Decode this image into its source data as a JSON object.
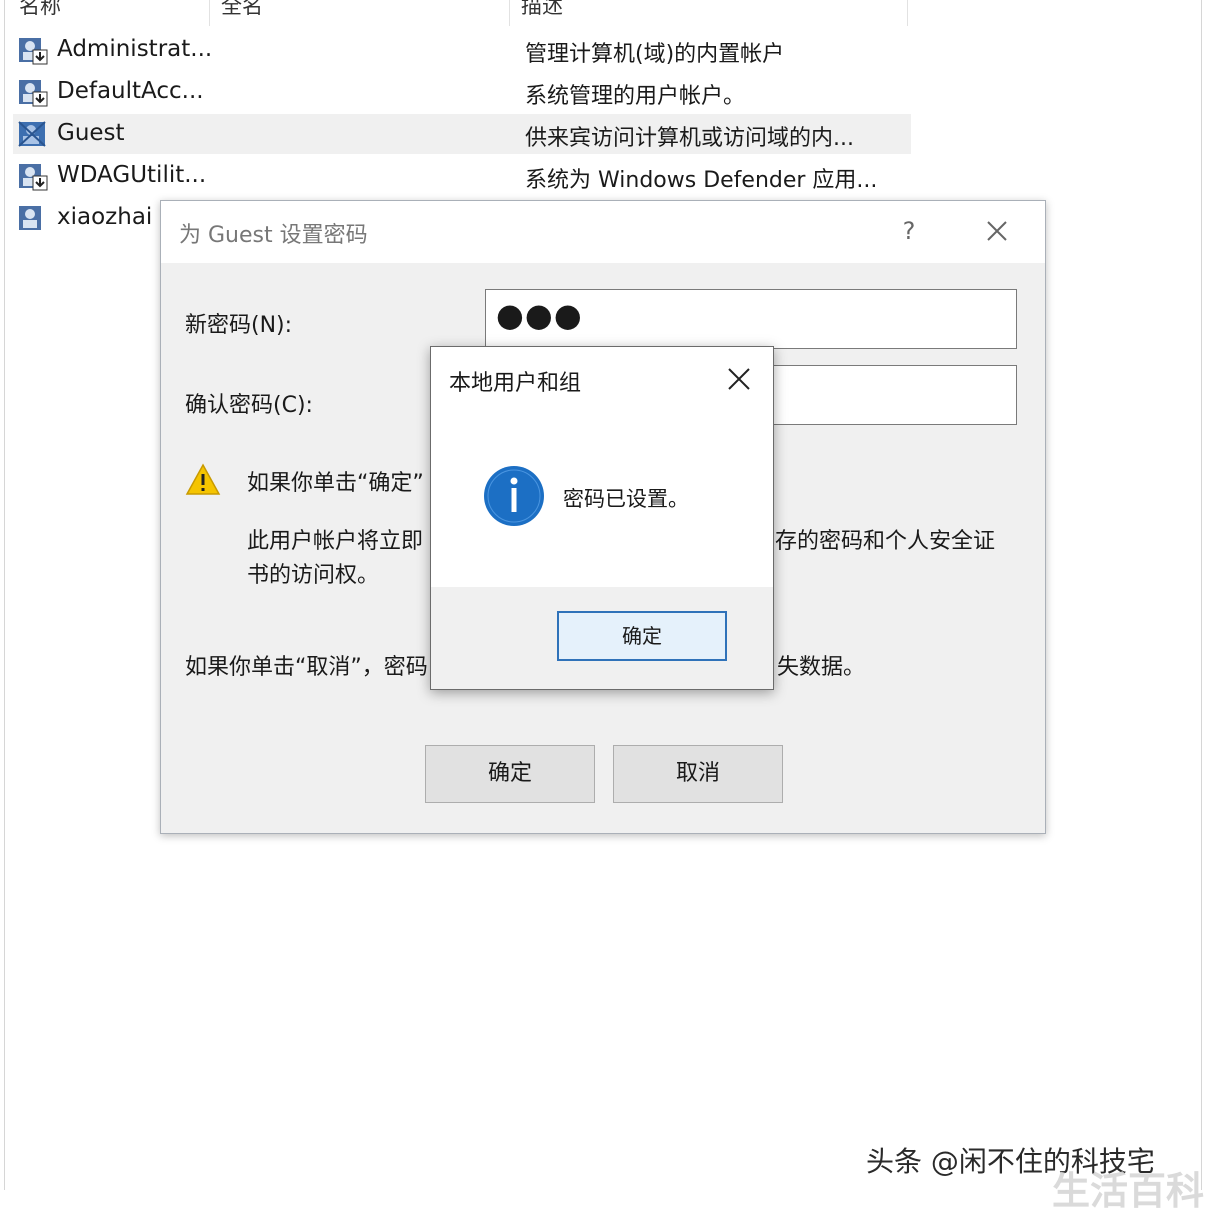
{
  "listview": {
    "columns": [
      "名称",
      "全名",
      "描述"
    ],
    "rows": [
      {
        "name": "Administrat...",
        "fullname": "",
        "desc": "管理计算机(域)的内置帐户"
      },
      {
        "name": "DefaultAcc...",
        "fullname": "",
        "desc": "系统管理的用户帐户。"
      },
      {
        "name": "Guest",
        "fullname": "",
        "desc": "供来宾访问计算机或访问域的内..."
      },
      {
        "name": "WDAGUtilit...",
        "fullname": "",
        "desc": "系统为 Windows Defender 应用..."
      },
      {
        "name": "xiaozhai",
        "fullname": "",
        "desc": ""
      }
    ],
    "selected_index": 2
  },
  "pwd_dialog": {
    "title": "为 Guest 设置密码",
    "help": "?",
    "new_password_label": "新密码(N):",
    "new_password_value": "●●●",
    "confirm_password_label": "确认密码(C):",
    "confirm_password_value": "",
    "warning_line1_left": "如果你单击“确定”",
    "warning_line2_left": "此用户帐户将立即",
    "warning_line2_right": "存的密码和个人安全证",
    "warning_line3": "书的访问权。",
    "cancel_note_left": "如果你单击“取消”，密码",
    "cancel_note_right": "失数据。",
    "ok_label": "确定",
    "cancel_label": "取消"
  },
  "msgbox": {
    "title": "本地用户和组",
    "message": "密码已设置。",
    "ok_label": "确定"
  },
  "watermarks": {
    "author": "头条 @闲不住的科技宅",
    "site": "生活百科"
  },
  "colors": {
    "info_blue": "#1c6fc4",
    "warning_yellow": "#f5c400",
    "focus_border": "#2f72b9"
  }
}
